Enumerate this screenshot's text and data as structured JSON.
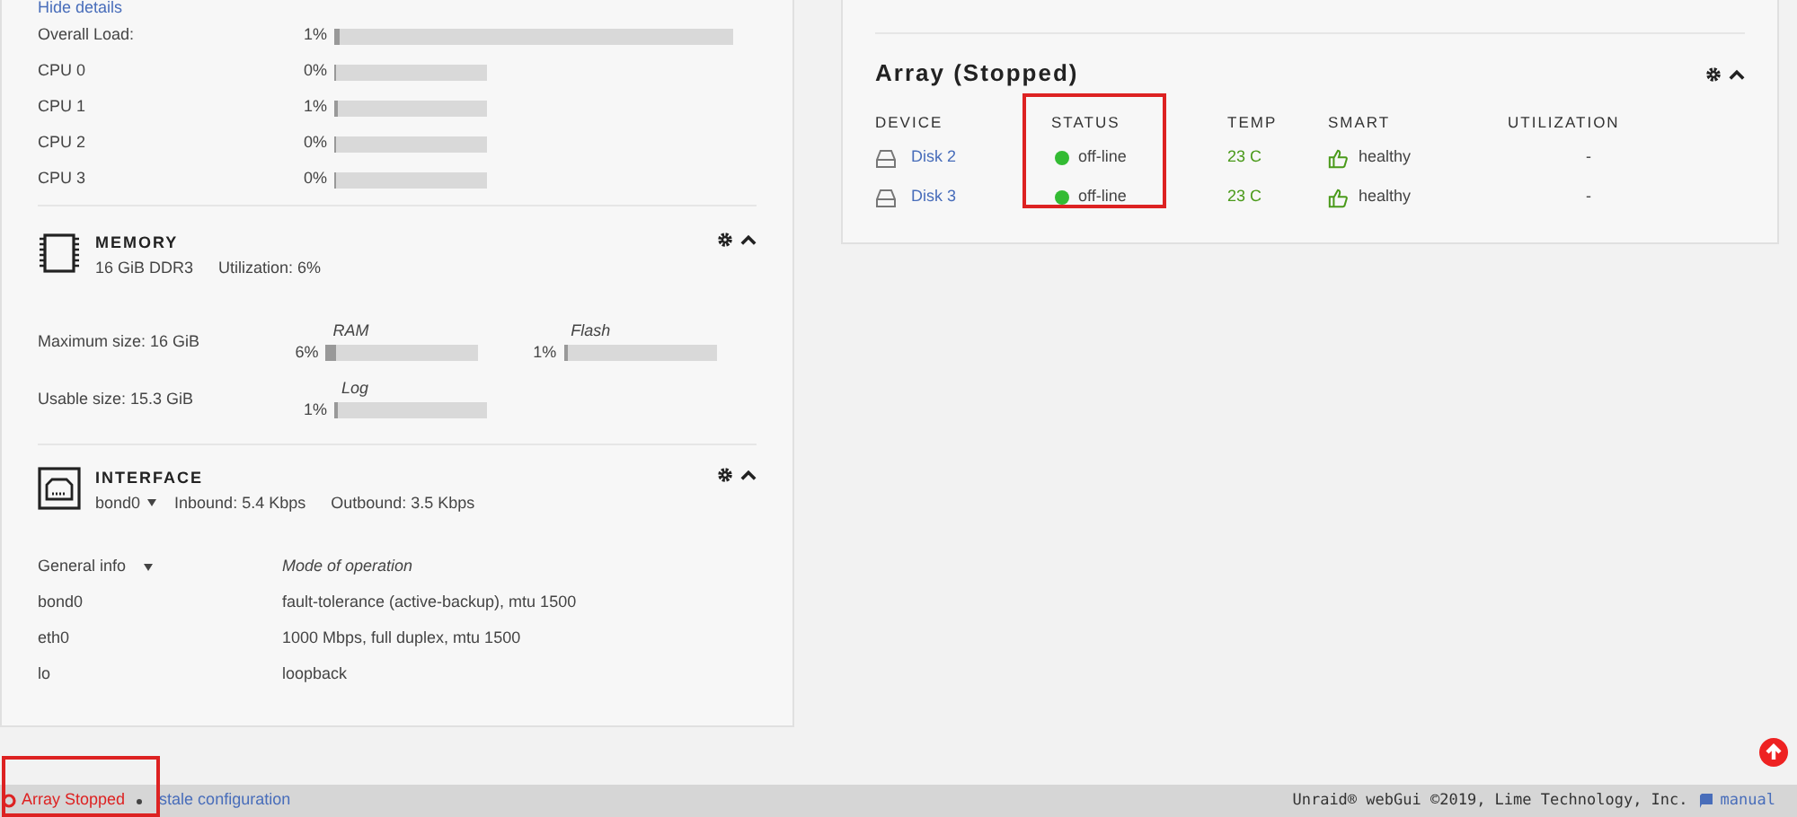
{
  "processor": {
    "toggle_link": "Hide details",
    "loads": [
      {
        "label": "Overall Load:",
        "reading": "1%",
        "level": 0.01,
        "wide": true
      },
      {
        "label": "CPU 0",
        "reading": "0%",
        "level": 0,
        "wide": false
      },
      {
        "label": "CPU 1",
        "reading": "1%",
        "level": 0.01,
        "wide": false
      },
      {
        "label": "CPU 2",
        "reading": "0%",
        "level": 0,
        "wide": false
      },
      {
        "label": "CPU 3",
        "reading": "0%",
        "level": 0,
        "wide": false
      }
    ]
  },
  "memory": {
    "title": "MEMORY",
    "summary": "16 GiB DDR3",
    "utilization": "Utilization: 6%",
    "rows": [
      {
        "label": "Maximum size: 16 GiB",
        "meters": [
          {
            "name": "RAM",
            "reading": "6%",
            "level": 0.06
          },
          {
            "name": "Flash",
            "reading": "1%",
            "level": 0.01
          }
        ]
      },
      {
        "label": "Usable size: 15.3 GiB",
        "meters": [
          {
            "name": "Log",
            "reading": "1%",
            "level": 0.01
          }
        ]
      }
    ]
  },
  "interface": {
    "title": "INTERFACE",
    "port": "bond0",
    "inbound": "Inbound: 5.4 Kbps",
    "outbound": "Outbound: 3.5 Kbps",
    "columns": [
      "General info",
      "Mode of operation"
    ],
    "rows": [
      {
        "name": "bond0",
        "value": "fault-tolerance (active-backup), mtu 1500"
      },
      {
        "name": "eth0",
        "value": "1000 Mbps, full duplex, mtu 1500"
      },
      {
        "name": "lo",
        "value": "loopback"
      }
    ]
  },
  "array": {
    "title": "Array (Stopped)",
    "columns": [
      {
        "label": "DEVICE",
        "highlighted": false
      },
      {
        "label": "STATUS",
        "highlighted": true
      },
      {
        "label": "TEMP",
        "highlighted": false
      },
      {
        "label": "SMART",
        "highlighted": false
      },
      {
        "label": "UTILIZATION",
        "highlighted": false
      }
    ],
    "rows": [
      {
        "device": "Disk 2",
        "status": "off-line",
        "color": "#33bb33",
        "temp": "23 C",
        "smart": "healthy",
        "utilization": "-"
      },
      {
        "device": "Disk 3",
        "status": "off-line",
        "color": "#33bb33",
        "temp": "23 C",
        "smart": "healthy",
        "utilization": "-"
      }
    ]
  },
  "status_bar": {
    "state": "Array Stopped",
    "state_highlighted": true,
    "note": "stale configuration",
    "copyright": "Unraid® webGui ©2019, Lime Technology, Inc.",
    "manual": "manual"
  }
}
